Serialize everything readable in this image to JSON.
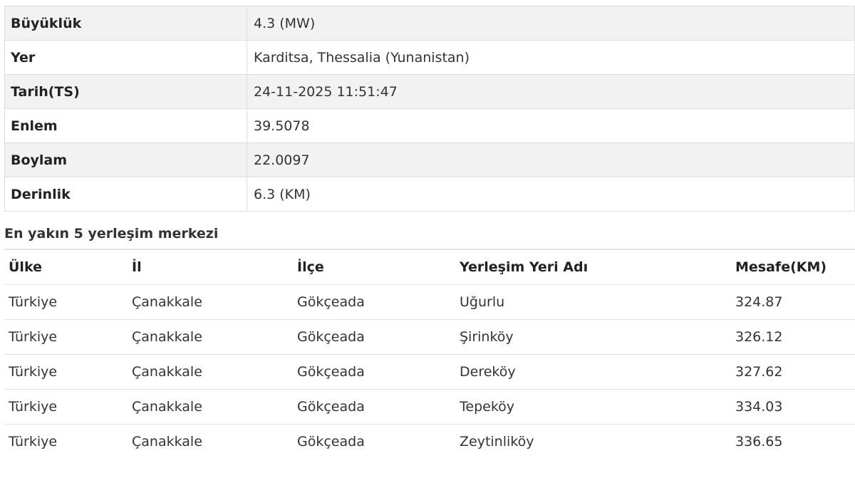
{
  "details": [
    {
      "key": "Büyüklük",
      "value": "4.3 (MW)"
    },
    {
      "key": "Yer",
      "value": "Karditsa, Thessalia (Yunanistan)"
    },
    {
      "key": "Tarih(TS)",
      "value": "24-11-2025 11:51:47"
    },
    {
      "key": "Enlem",
      "value": "39.5078"
    },
    {
      "key": "Boylam",
      "value": "22.0097"
    },
    {
      "key": "Derinlik",
      "value": "6.3 (KM)"
    }
  ],
  "nearby": {
    "title": "En yakın 5 yerleşim merkezi",
    "headers": [
      "Ülke",
      "İl",
      "İlçe",
      "Yerleşim Yeri Adı",
      "Mesafe(KM)"
    ],
    "rows": [
      [
        "Türkiye",
        "Çanakkale",
        "Gökçeada",
        "Uğurlu",
        "324.87"
      ],
      [
        "Türkiye",
        "Çanakkale",
        "Gökçeada",
        "Şirinköy",
        "326.12"
      ],
      [
        "Türkiye",
        "Çanakkale",
        "Gökçeada",
        "Dereköy",
        "327.62"
      ],
      [
        "Türkiye",
        "Çanakkale",
        "Gökçeada",
        "Tepeköy",
        "334.03"
      ],
      [
        "Türkiye",
        "Çanakkale",
        "Gökçeada",
        "Zeytinliköy",
        "336.65"
      ]
    ]
  }
}
